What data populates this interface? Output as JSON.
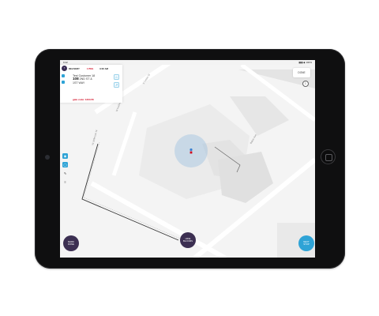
{
  "statusbar": {
    "time": "9:42",
    "right": "▮▮▮ ◆ 100%"
  },
  "map_controls": {
    "done_label": "DONE",
    "info_symbol": "i"
  },
  "card": {
    "avatar_text": "T",
    "title": "DELIVERY",
    "flag": "1 PKG",
    "time": "9:00 AM",
    "customer": "Test Customer 18",
    "number": "108",
    "street": "2ND ST &",
    "street2": "1ST WAY",
    "gate_code": "gate code: 1234.56",
    "action1": "⌂",
    "action2": "↗"
  },
  "tools": [
    "◉",
    "◯",
    "✎",
    "≡"
  ],
  "buttons": {
    "left": {
      "line1": "MARK",
      "line2": "DONE"
    },
    "mid": {
      "line1": "HIDE",
      "line2": "BLOOMS"
    },
    "right": {
      "line1": "NEXT",
      "line2": "STOP"
    }
  },
  "streets": {
    "a": "S Cedar St",
    "b": "W Hudson Ave",
    "c": "W Jefferson St",
    "d": "Baker Ave"
  }
}
